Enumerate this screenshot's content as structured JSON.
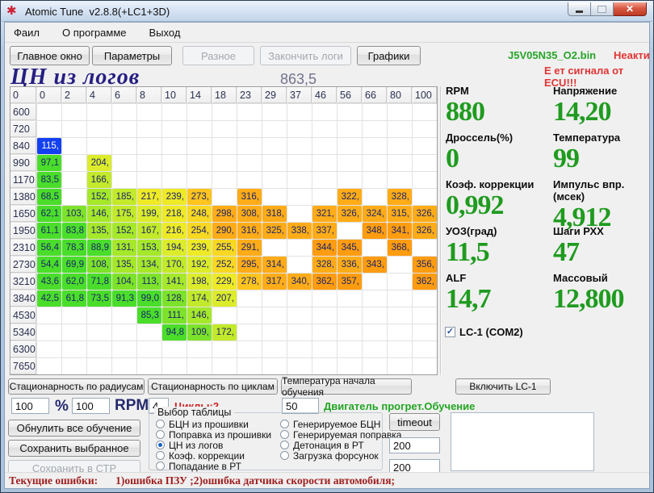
{
  "window": {
    "title": "Atomic Tune  v2.8.8(+LC1+3D)"
  },
  "menu": {
    "items": [
      "Фаил",
      "О программе",
      "Выход"
    ]
  },
  "toolbar": {
    "buttons": [
      {
        "label": "Главное окно",
        "enabled": true
      },
      {
        "label": "Параметры",
        "enabled": true
      },
      {
        "label": "Разное",
        "enabled": false
      },
      {
        "label": "Закончить логи",
        "enabled": false
      },
      {
        "label": "Графики",
        "enabled": true
      }
    ],
    "file_name": "J5V05N35_O2.bin",
    "lc1_state": "Неактивен",
    "ecu_signal": "Е ет сигнала от ECU!!!"
  },
  "grid": {
    "title": "ЦН из логов",
    "current_value": "863,5",
    "columns": [
      "0",
      "0",
      "2",
      "4",
      "6",
      "8",
      "10",
      "14",
      "18",
      "23",
      "29",
      "37",
      "46",
      "56",
      "66",
      "80",
      "100"
    ],
    "rows": [
      {
        "label": "600",
        "cells": [
          null,
          null,
          null,
          null,
          null,
          null,
          null,
          null,
          null,
          null,
          null,
          null,
          null,
          null,
          null,
          null
        ]
      },
      {
        "label": "720",
        "cells": [
          null,
          null,
          null,
          null,
          null,
          null,
          null,
          null,
          null,
          null,
          null,
          null,
          null,
          null,
          null,
          null
        ]
      },
      {
        "label": "840",
        "cells": [
          "115,",
          null,
          null,
          null,
          null,
          null,
          null,
          null,
          null,
          null,
          null,
          null,
          null,
          null,
          null,
          null
        ]
      },
      {
        "label": "990",
        "cells": [
          "97,1",
          null,
          "204,",
          null,
          null,
          null,
          null,
          null,
          null,
          null,
          null,
          null,
          null,
          null,
          null,
          null
        ]
      },
      {
        "label": "1170",
        "cells": [
          "83,5",
          null,
          "166,",
          null,
          null,
          null,
          null,
          null,
          null,
          null,
          null,
          null,
          null,
          null,
          null,
          null
        ]
      },
      {
        "label": "1380",
        "cells": [
          "68,5",
          null,
          "152,",
          "185,",
          "217,",
          "239,",
          "273,",
          null,
          "316,",
          null,
          null,
          null,
          "322,",
          null,
          "328,",
          null
        ]
      },
      {
        "label": "1650",
        "cells": [
          "62,1",
          "103,",
          "146,",
          "175,",
          "199,",
          "218,",
          "248,",
          "298,",
          "308,",
          "318,",
          null,
          "321,",
          "326,",
          "324,",
          "315,",
          "326,"
        ]
      },
      {
        "label": "1950",
        "cells": [
          "61,1",
          "83,8",
          "135,",
          "152,",
          "167,",
          "216,",
          "254,",
          "290,",
          "316,",
          "325,",
          "338,",
          "337,",
          null,
          "348,",
          "341,",
          "326,"
        ]
      },
      {
        "label": "2310",
        "cells": [
          "56,4",
          "78,3",
          "88,9",
          "131,",
          "153,",
          "194,",
          "239,",
          "255,",
          "291,",
          null,
          null,
          "344,",
          "345,",
          null,
          "368,",
          null
        ]
      },
      {
        "label": "2730",
        "cells": [
          "54,4",
          "69,9",
          "108,",
          "135,",
          "134,",
          "170,",
          "192,",
          "252,",
          "295,",
          "314,",
          null,
          "328,",
          "336,",
          "343,",
          null,
          "356,"
        ]
      },
      {
        "label": "3210",
        "cells": [
          "43,6",
          "62,0",
          "71,8",
          "104,",
          "113,",
          "141,",
          "198,",
          "229,",
          "278,",
          "317,",
          "340,",
          "362,",
          "357,",
          null,
          null,
          "362,"
        ]
      },
      {
        "label": "3840",
        "cells": [
          "42,5",
          "61,8",
          "73,5",
          "91,3",
          "99,0",
          "128,",
          "174,",
          "207,",
          null,
          null,
          null,
          null,
          null,
          null,
          null,
          null
        ]
      },
      {
        "label": "4530",
        "cells": [
          null,
          null,
          null,
          null,
          "85,3",
          "111,",
          "146,",
          null,
          null,
          null,
          null,
          null,
          null,
          null,
          null,
          null
        ]
      },
      {
        "label": "5340",
        "cells": [
          null,
          null,
          null,
          null,
          null,
          "94,8",
          "109,",
          "172,",
          null,
          null,
          null,
          null,
          null,
          null,
          null,
          null
        ]
      },
      {
        "label": "6300",
        "cells": [
          null,
          null,
          null,
          null,
          null,
          null,
          null,
          null,
          null,
          null,
          null,
          null,
          null,
          null,
          null,
          null
        ]
      },
      {
        "label": "7650",
        "cells": [
          null,
          null,
          null,
          null,
          null,
          null,
          null,
          null,
          null,
          null,
          null,
          null,
          null,
          null,
          null,
          null
        ]
      }
    ],
    "selected_cell": {
      "row": "840",
      "col": 0
    },
    "colors": {
      "selected_bg": "#1340f0",
      "selected_text": "#ffffff",
      "scale": [
        {
          "max": 100,
          "color": "#4ade2a"
        },
        {
          "max": 130,
          "color": "#7de32a"
        },
        {
          "max": 160,
          "color": "#a6e82a"
        },
        {
          "max": 190,
          "color": "#c3ea2a"
        },
        {
          "max": 215,
          "color": "#dcec2a"
        },
        {
          "max": 245,
          "color": "#eeea26"
        },
        {
          "max": 265,
          "color": "#f8d822"
        },
        {
          "max": 285,
          "color": "#ffc41e"
        },
        {
          "max": 340,
          "color": "#ffac18"
        },
        {
          "max": 99999,
          "color": "#ff9c10"
        }
      ]
    }
  },
  "readouts": {
    "left": [
      {
        "label": "RPM",
        "value": "880"
      },
      {
        "label": "Дроссель(%)",
        "value": "0"
      },
      {
        "label": "Коэф. коррекции",
        "value": "0,992"
      },
      {
        "label": "УОЗ(град)",
        "value": "11,5"
      },
      {
        "label": "ALF",
        "value": "14,7"
      }
    ],
    "right": [
      {
        "label": "Напряжение",
        "value": "14,20"
      },
      {
        "label": "Температура",
        "value": "99"
      },
      {
        "label": "Импульс впр.(мсек)",
        "value": "4,912"
      },
      {
        "label": "Шаги РХХ",
        "value": "47"
      },
      {
        "label": "Массовый",
        "value": "12,800"
      }
    ]
  },
  "lc1_checkbox": {
    "label": "LC-1 (COM2)",
    "checked": true,
    "check_glyph": "✓"
  },
  "controls": {
    "stat_radius_btn": "Стационарность по радиусам",
    "stat_cycles_btn": "Стационарность по циклам",
    "temp_learn_btn": "Температура начала обучения",
    "enable_lc1_btn": "Включить LC-1",
    "percent_value": "100",
    "percent_label": "%",
    "rpm_value": "100",
    "rpm_label": "RPM",
    "cycles_value": "4",
    "cycles_label": "Циклы:2",
    "temp_value": "50",
    "engine_warm_label": "Двигатель прогрет.Обучение",
    "reset_btn": "Обнулить все обучение",
    "save_selected_btn": "Сохранить выбранное",
    "save_ctp_btn": "Сохранить в СТР",
    "timeout_btn": "timeout",
    "timeout1_value": "200",
    "timeout2_value": "200",
    "table_select": {
      "legend": "Выбор таблицы",
      "col_a": [
        "БЦН из прошивки",
        "Поправка из прошивки",
        "ЦН из логов",
        "Коэф. коррекции",
        "Попадание в РТ"
      ],
      "col_b": [
        "Генерируемое БЦН",
        "Генерируемая поправка",
        "Детонация в РТ",
        "Загрузка форсунок"
      ],
      "selected": "ЦН из логов"
    }
  },
  "status_bar": {
    "prefix": "Текущие ошибки:",
    "text": "1)ошибка ПЗУ ;2)ошибка датчика скорости автомобиля;"
  }
}
